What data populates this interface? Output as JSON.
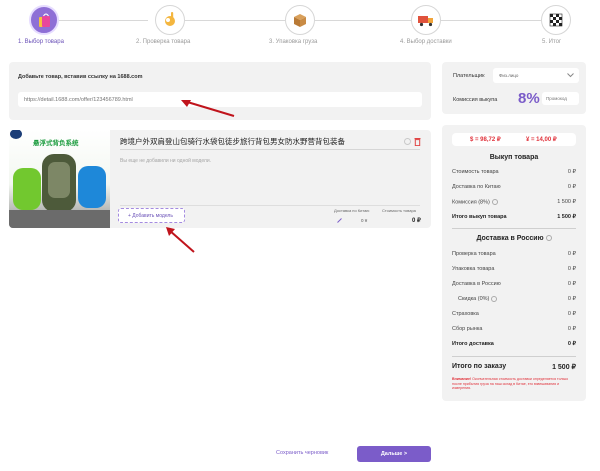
{
  "steps": [
    {
      "label": "1. Выбор товара",
      "icon": "shopping-bag-icon"
    },
    {
      "label": "2. Проверка товара",
      "icon": "ok-hand-icon"
    },
    {
      "label": "3. Упаковка груза",
      "icon": "box-icon"
    },
    {
      "label": "4. Выбор доставки",
      "icon": "truck-icon"
    },
    {
      "label": "5. Итог",
      "icon": "finish-flag-icon"
    }
  ],
  "add_product": {
    "title": "Добавьте товар, вставив ссылку на 1688.com",
    "placeholder": "https://detail.1688.com/offer/123456789.html"
  },
  "payer": {
    "label": "Плательщик",
    "value": "Физ.лицо",
    "commission_label": "Комиссия выкупа",
    "commission_value": "8%",
    "promo_placeholder": "Промокод"
  },
  "product": {
    "image_text": "悬浮式背负系统",
    "title": "跨境户外双肩登山包骑行水袋包徒步旅行背包男女防水野营背包装备",
    "no_models": "Вы еще не добавили ни одной модели.",
    "add_model": "+ Добавить модель",
    "delivery_label": "Доставка по Китаю",
    "delivery_value": "0 ¥",
    "cost_label": "Стоимость товара",
    "cost_value": "0 ₽"
  },
  "rates": {
    "usd": "$ = 98,72 ₽",
    "cny": "¥ = 14,00 ₽"
  },
  "buyout": {
    "title": "Выкуп товара",
    "rows": [
      {
        "label": "Стоимость товара",
        "value": "0 ₽"
      },
      {
        "label": "Доставка по Китаю",
        "value": "0 ₽"
      },
      {
        "label": "Комиссия (8%)",
        "value": "1 500 ₽"
      }
    ],
    "total_label": "Итого выкуп товара",
    "total_value": "1 500 ₽"
  },
  "russia": {
    "title": "Доставка в Россию",
    "rows": [
      {
        "label": "Проверка товара",
        "value": "0 ₽"
      },
      {
        "label": "Упаковка товара",
        "value": "0 ₽"
      },
      {
        "label": "Доставка в Россию",
        "value": "0 ₽"
      },
      {
        "label": "Скидка (0%)",
        "value": "0 ₽"
      },
      {
        "label": "Страховка",
        "value": "0 ₽"
      },
      {
        "label": "Сбор рынка",
        "value": "0 ₽"
      }
    ],
    "total_label": "Итого доставка",
    "total_value": "0 ₽"
  },
  "order_total": {
    "label": "Итого по заказу",
    "value": "1 500 ₽"
  },
  "notice": {
    "strong": "Внимание!",
    "text": " Окончательная стоимость доставки определяется только после прибытия груза на наш склад в Китае, его взвешивания и измерения."
  },
  "actions": {
    "draft": "Сохранить черновик",
    "next": "Дальше >"
  },
  "colors": {
    "accent": "#7b5cc9",
    "arrow": "#c0141c",
    "rate": "#e0313a"
  }
}
